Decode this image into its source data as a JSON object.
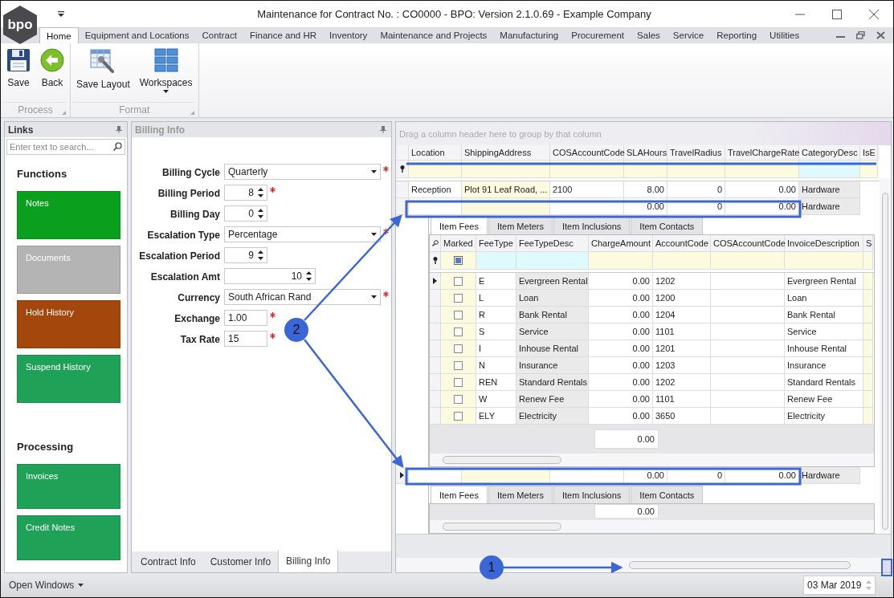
{
  "window": {
    "title": "Maintenance for Contract No. : CO0000  - BPO: Version 2.1.0.69 - Example Company",
    "logo": "bpo"
  },
  "ribbon_tabs": [
    {
      "label": "Home",
      "selected": true
    },
    {
      "label": "Equipment and Locations",
      "selected": false
    },
    {
      "label": "Contract",
      "selected": false
    },
    {
      "label": "Finance and HR",
      "selected": false
    },
    {
      "label": "Inventory",
      "selected": false
    },
    {
      "label": "Maintenance and Projects",
      "selected": false
    },
    {
      "label": "Manufacturing",
      "selected": false
    },
    {
      "label": "Procurement",
      "selected": false
    },
    {
      "label": "Sales",
      "selected": false
    },
    {
      "label": "Service",
      "selected": false
    },
    {
      "label": "Reporting",
      "selected": false
    },
    {
      "label": "Utilities",
      "selected": false
    }
  ],
  "ribbon_groups": [
    {
      "label": "Process",
      "buttons": [
        {
          "label": "Save",
          "kind": "save",
          "dropdown": false
        },
        {
          "label": "Back",
          "kind": "back",
          "dropdown": false
        }
      ]
    },
    {
      "label": "Format",
      "buttons": [
        {
          "label": "Save Layout",
          "kind": "layout",
          "dropdown": false
        },
        {
          "label": "Workspaces",
          "kind": "workspaces",
          "dropdown": true
        }
      ]
    }
  ],
  "links": {
    "title": "Links",
    "search_placeholder": "Enter text to search...",
    "sections": [
      {
        "heading": "Functions",
        "items": [
          {
            "label": "Notes",
            "color": "#0a9f1c"
          },
          {
            "label": "Documents",
            "color": "#b4b4b4"
          },
          {
            "label": "Hold History",
            "color": "#a4470c"
          },
          {
            "label": "Suspend History",
            "color": "#1fa158"
          }
        ]
      },
      {
        "heading": "Processing",
        "items": [
          {
            "label": "Invoices",
            "color": "#1fa158"
          },
          {
            "label": "Credit Notes",
            "color": "#1fa158"
          }
        ]
      }
    ]
  },
  "billing": {
    "title": "Billing Info",
    "fields": [
      {
        "label": "Billing Cycle",
        "kind": "select",
        "value": "Quarterly",
        "required": true
      },
      {
        "label": "Billing Period",
        "kind": "spin",
        "value": "8",
        "required": true
      },
      {
        "label": "Billing Day",
        "kind": "spin",
        "value": "0",
        "required": false
      },
      {
        "label": "Escalation Type",
        "kind": "select",
        "value": "Percentage",
        "required": true
      },
      {
        "label": "Escalation Period",
        "kind": "spin",
        "value": "9",
        "required": false
      },
      {
        "label": "Escalation Amt",
        "kind": "amount",
        "value": "10",
        "required": false
      },
      {
        "label": "Currency",
        "kind": "select",
        "value": "South African Rand",
        "required": true
      },
      {
        "label": "Exchange",
        "kind": "text",
        "value": "1.00",
        "required": true
      },
      {
        "label": "Tax Rate",
        "kind": "text",
        "value": "15",
        "required": true
      }
    ],
    "tabs": [
      {
        "label": "Contract Info",
        "selected": false
      },
      {
        "label": "Customer Info",
        "selected": false
      },
      {
        "label": "Billing Info",
        "selected": true
      }
    ]
  },
  "grid": {
    "group_hint": "Drag a column header here to group by that column",
    "columns": [
      "Location",
      "ShippingAddress",
      "COSAccountCode",
      "SLAHours",
      "TravelRadius",
      "TravelChargeRate",
      "CategoryDesc",
      "IsE"
    ],
    "rows": [
      {
        "cells": [
          "Reception",
          "Plot 91 Leaf Road, ...",
          "2100",
          "8.00",
          "0",
          "0.00",
          "Hardware"
        ],
        "focused": false,
        "detail": null
      },
      {
        "cells": [
          "",
          "",
          "",
          "0.00",
          "0",
          "0.00",
          "Hardware"
        ],
        "focused": false,
        "detail": {
          "tabs": [
            {
              "label": "Item Fees",
              "selected": true
            },
            {
              "label": "Item Meters",
              "selected": false
            },
            {
              "label": "Item Inclusions",
              "selected": false
            },
            {
              "label": "Item Contacts",
              "selected": false
            }
          ],
          "columns": [
            "Marked",
            "FeeType",
            "FeeTypeDesc",
            "ChargeAmount",
            "AccountCode",
            "COSAccountCode",
            "InvoiceDescription",
            "S"
          ],
          "filter_marked": true,
          "rows": [
            {
              "focused": true,
              "marked": false,
              "cells": [
                "",
                "E",
                "Evergreen Rental",
                "0.00",
                "1202",
                "",
                "Evergreen Rental"
              ]
            },
            {
              "focused": false,
              "marked": false,
              "cells": [
                "",
                "L",
                "Loan",
                "0.00",
                "1200",
                "",
                "Loan"
              ]
            },
            {
              "focused": false,
              "marked": false,
              "cells": [
                "",
                "R",
                "Bank Rental",
                "0.00",
                "1204",
                "",
                "Bank Rental"
              ]
            },
            {
              "focused": false,
              "marked": false,
              "cells": [
                "",
                "S",
                "Service",
                "0.00",
                "1101",
                "",
                "Service"
              ]
            },
            {
              "focused": false,
              "marked": false,
              "cells": [
                "",
                "I",
                "Inhouse Rental",
                "0.00",
                "1201",
                "",
                "Inhouse Rental"
              ]
            },
            {
              "focused": false,
              "marked": false,
              "cells": [
                "",
                "N",
                "Insurance",
                "0.00",
                "1203",
                "",
                "Insurance"
              ]
            },
            {
              "focused": false,
              "marked": false,
              "cells": [
                "",
                "REN",
                "Standard Rentals",
                "0.00",
                "1202",
                "",
                "Standard Rentals"
              ]
            },
            {
              "focused": false,
              "marked": false,
              "cells": [
                "",
                "W",
                "Renew Fee",
                "0.00",
                "1101",
                "",
                "Renew Fee"
              ]
            },
            {
              "focused": false,
              "marked": false,
              "cells": [
                "",
                "ELY",
                "Electricity",
                "0.00",
                "3650",
                "",
                "Electricity"
              ]
            }
          ],
          "total": "0.00"
        }
      },
      {
        "cells": [
          "",
          "",
          "",
          "0.00",
          "0",
          "0.00",
          "Hardware"
        ],
        "focused": true,
        "detail": {
          "tabs": [
            {
              "label": "Item Fees",
              "selected": true
            },
            {
              "label": "Item Meters",
              "selected": false
            },
            {
              "label": "Item Inclusions",
              "selected": false
            },
            {
              "label": "Item Contacts",
              "selected": false
            }
          ],
          "total": "0.00"
        }
      }
    ]
  },
  "status": {
    "open_windows": "Open Windows",
    "date": "03 Mar 2019"
  },
  "annotations": [
    {
      "label": "1"
    },
    {
      "label": "2"
    }
  ]
}
